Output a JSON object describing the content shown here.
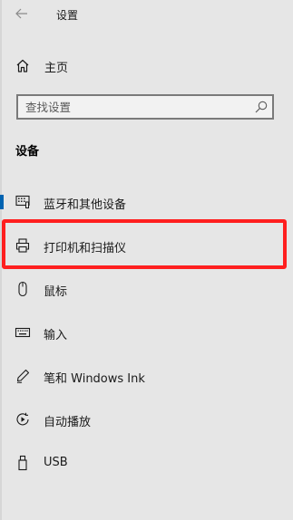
{
  "window": {
    "title": "设置",
    "back_icon": "back-arrow-icon"
  },
  "home": {
    "label": "主页",
    "icon": "home-icon"
  },
  "search": {
    "placeholder": "查找设置",
    "value": "",
    "icon": "search-icon"
  },
  "section": {
    "title": "设备"
  },
  "nav": {
    "items": [
      {
        "label": "蓝牙和其他设备",
        "icon": "bluetooth-devices-icon",
        "selected": true
      },
      {
        "label": "打印机和扫描仪",
        "icon": "printer-icon",
        "highlighted": true
      },
      {
        "label": "鼠标",
        "icon": "mouse-icon"
      },
      {
        "label": "输入",
        "icon": "keyboard-icon"
      },
      {
        "label": "笔和 Windows Ink",
        "icon": "pen-icon"
      },
      {
        "label": "自动播放",
        "icon": "autoplay-icon"
      },
      {
        "label": "USB",
        "icon": "usb-icon"
      }
    ]
  },
  "colors": {
    "background": "#e6e6e6",
    "accent": "#0063b1",
    "annotation_highlight": "#ff1f1f"
  }
}
